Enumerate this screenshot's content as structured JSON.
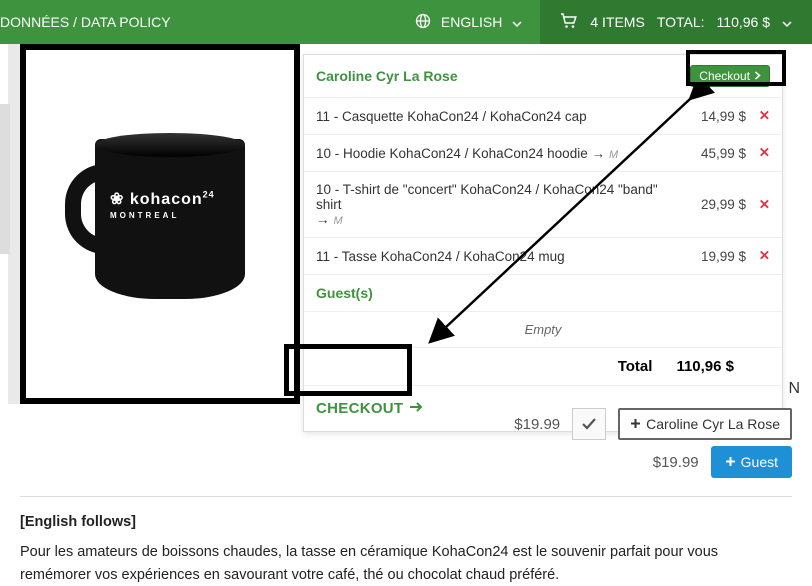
{
  "topbar": {
    "policy": "DONNÉES / DATA POLICY",
    "language": "ENGLISH",
    "cart_items": "4 ITEMS",
    "cart_total_label": "TOTAL:",
    "cart_total_value": "110,96 $"
  },
  "product_image": {
    "logo_text": "kohacon",
    "logo_suffix": "24",
    "logo_sub": "MONTREAL"
  },
  "dropdown": {
    "owner": "Caroline Cyr La Rose",
    "checkout_small": "Checkout",
    "items": [
      {
        "label": "11 - Casquette KohaCon24 / KohaCon24 cap",
        "suffix": "",
        "price": "14,99 $"
      },
      {
        "label": "10 - Hoodie KohaCon24 / KohaCon24 hoodie",
        "suffix": "M",
        "price": "45,99 $"
      },
      {
        "label": "10 - T-shirt de \"concert\" KohaCon24 / KohaCon24 \"band\" shirt",
        "suffix": "M",
        "price": "29,99 $"
      },
      {
        "label": "11 - Tasse KohaCon24 / KohaCon24 mug",
        "suffix": "",
        "price": "19,99 $"
      }
    ],
    "guests_header": "Guest(s)",
    "empty_text": "Empty",
    "total_label": "Total",
    "total_value": "110,96 $",
    "checkout_big": "CHECKOUT"
  },
  "below": {
    "price1": "$19.99",
    "price2": "$19.99",
    "add_user_name": "Caroline Cyr La Rose",
    "guest_btn": "Guest",
    "english_follows": "[English follows]",
    "description_fr": "Pour les amateurs de boissons chaudes, la tasse en céramique KohaCon24 est le souvenir parfait pour vous remémorer vos expériences en savourant votre café, thé ou chocolat chaud préféré."
  },
  "visible_fragment": "N"
}
